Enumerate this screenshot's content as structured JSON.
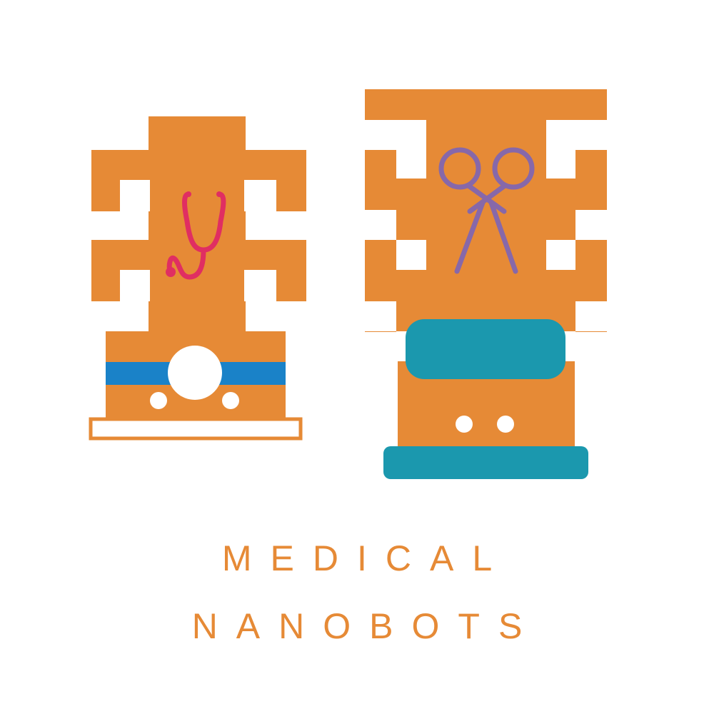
{
  "title": {
    "line1": "MEDICAL",
    "line2": "NANOBOTS"
  },
  "colors": {
    "orange": "#E68A36",
    "teal": "#1B98AE",
    "blue": "#1A82C8",
    "pink": "#E02E62",
    "purple": "#8768A9",
    "white": "#FFFFFF"
  },
  "icons": {
    "left_robot_tool": "stethoscope-icon",
    "right_robot_tool": "scissors-icon"
  }
}
